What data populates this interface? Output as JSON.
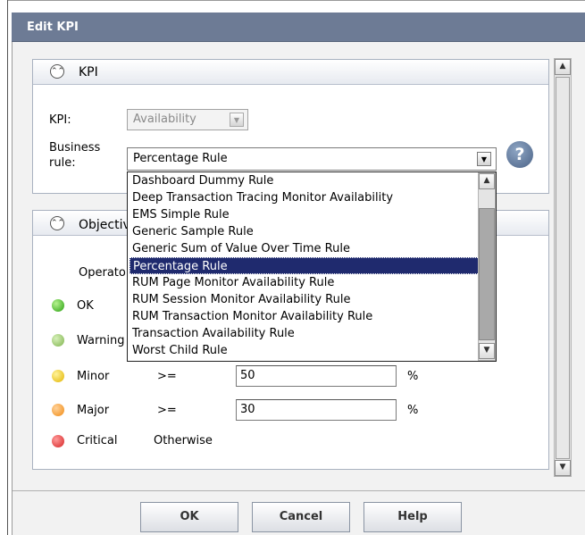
{
  "dialog": {
    "title": "Edit KPI"
  },
  "kpi_panel": {
    "title": "KPI",
    "kpi_label": "KPI:",
    "kpi_value": "Availability",
    "business_rule_label_1": "Business",
    "business_rule_label_2": "rule:",
    "business_rule_value": "Percentage Rule",
    "help_glyph": "?"
  },
  "objectives_panel": {
    "title": "Objectives",
    "operator_header": "Operator",
    "rows": [
      {
        "label": "OK",
        "icon": "green-circle",
        "operator": "",
        "value": "",
        "unit": ""
      },
      {
        "label": "Warning",
        "icon": "green-warning",
        "operator": "",
        "value": "",
        "unit": ""
      },
      {
        "label": "Minor",
        "icon": "yellow-warning",
        "operator": ">=",
        "value": "50",
        "unit": "%"
      },
      {
        "label": "Major",
        "icon": "orange-warning",
        "operator": ">=",
        "value": "30",
        "unit": "%"
      },
      {
        "label": "Critical",
        "icon": "red-critical",
        "operator": "Otherwise",
        "value": "",
        "unit": ""
      }
    ]
  },
  "dropdown": {
    "options": [
      "Dashboard Dummy Rule",
      "Deep Transaction Tracing Monitor Availability",
      "EMS Simple Rule",
      "Generic Sample Rule",
      "Generic Sum of Value Over Time Rule",
      "Percentage Rule",
      "RUM Page Monitor Availability Rule",
      "RUM Session Monitor Availability Rule",
      "RUM Transaction Monitor Availability Rule",
      "Transaction Availability Rule",
      "Worst Child Rule"
    ],
    "selected_index": 5
  },
  "buttons": {
    "ok": "OK",
    "cancel": "Cancel",
    "help": "Help"
  },
  "glyphs": {
    "collapse": "⌃⌃",
    "up": "▲",
    "down": "▼"
  },
  "colors": {
    "titlebar": "#6d7b95",
    "selection": "#1f2a6e"
  }
}
